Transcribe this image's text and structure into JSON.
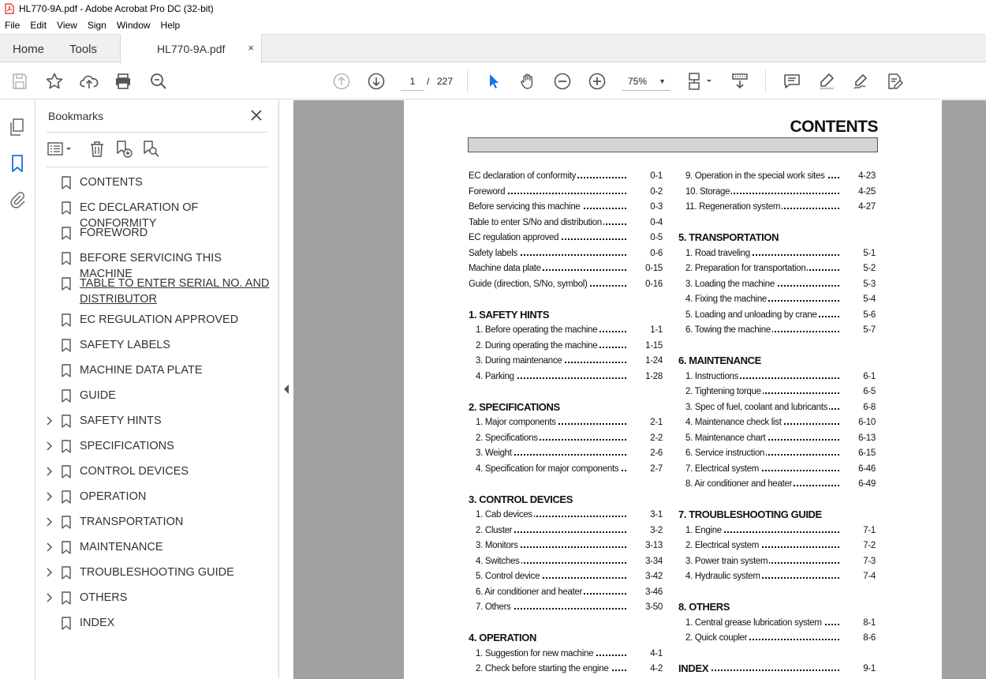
{
  "window": {
    "title": "HL770-9A.pdf - Adobe Acrobat Pro DC (32-bit)"
  },
  "menu": [
    "File",
    "Edit",
    "View",
    "Sign",
    "Window",
    "Help"
  ],
  "tabs": {
    "home": "Home",
    "tools": "Tools",
    "document": "HL770-9A.pdf",
    "close": "×"
  },
  "toolbar": {
    "page_current": "1",
    "page_sep": "/",
    "page_total": "227",
    "zoom": "75%"
  },
  "bookmarks": {
    "title": "Bookmarks",
    "items": [
      {
        "label": "CONTENTS",
        "expandable": false
      },
      {
        "label": "EC DECLARATION OF CONFORMITY",
        "expandable": false
      },
      {
        "label": "FOREWORD",
        "expandable": false
      },
      {
        "label": "BEFORE SERVICING THIS MACHINE",
        "expandable": false
      },
      {
        "label": "TABLE TO ENTER SERIAL NO. AND DISTRIBUTOR",
        "expandable": false,
        "hovered": true
      },
      {
        "label": "EC REGULATION APPROVED",
        "expandable": false
      },
      {
        "label": "SAFETY LABELS",
        "expandable": false
      },
      {
        "label": "MACHINE DATA PLATE",
        "expandable": false
      },
      {
        "label": "GUIDE",
        "expandable": false
      },
      {
        "label": "SAFETY HINTS",
        "expandable": true
      },
      {
        "label": "SPECIFICATIONS",
        "expandable": true
      },
      {
        "label": "CONTROL DEVICES",
        "expandable": true
      },
      {
        "label": "OPERATION",
        "expandable": true
      },
      {
        "label": "TRANSPORTATION",
        "expandable": true
      },
      {
        "label": "MAINTENANCE",
        "expandable": true
      },
      {
        "label": "TROUBLESHOOTING GUIDE",
        "expandable": true
      },
      {
        "label": "OTHERS",
        "expandable": true
      },
      {
        "label": "INDEX",
        "expandable": false
      }
    ]
  },
  "document": {
    "heading": "CONTENTS",
    "left_column": [
      {
        "type": "entry",
        "label": "EC declaration of conformity",
        "page": "0-1"
      },
      {
        "type": "entry",
        "label": "Foreword",
        "page": "0-2"
      },
      {
        "type": "entry",
        "label": "Before servicing this machine",
        "page": "0-3"
      },
      {
        "type": "entry",
        "label": "Table to enter S/No and distribution",
        "page": "0-4"
      },
      {
        "type": "entry",
        "label": "EC regulation approved",
        "page": "0-5"
      },
      {
        "type": "entry",
        "label": "Safety labels",
        "page": "0-6"
      },
      {
        "type": "entry",
        "label": "Machine data plate",
        "page": "0-15"
      },
      {
        "type": "entry",
        "label": "Guide (direction, S/No, symbol)",
        "page": "0-16"
      },
      {
        "type": "head",
        "label": "1. SAFETY HINTS"
      },
      {
        "type": "sub",
        "label": "1. Before operating the machine",
        "page": "1-1"
      },
      {
        "type": "sub",
        "label": "2. During operating the machine",
        "page": "1-15"
      },
      {
        "type": "sub",
        "label": "3. During maintenance",
        "page": "1-24"
      },
      {
        "type": "sub",
        "label": "4. Parking",
        "page": "1-28"
      },
      {
        "type": "head",
        "label": "2. SPECIFICATIONS"
      },
      {
        "type": "sub",
        "label": "1. Major components",
        "page": "2-1"
      },
      {
        "type": "sub",
        "label": "2. Specifications",
        "page": "2-2"
      },
      {
        "type": "sub",
        "label": "3. Weight",
        "page": "2-6"
      },
      {
        "type": "sub",
        "label": "4. Specification for major components",
        "page": "2-7"
      },
      {
        "type": "head",
        "label": "3. CONTROL DEVICES"
      },
      {
        "type": "sub",
        "label": "1. Cab devices",
        "page": "3-1"
      },
      {
        "type": "sub",
        "label": "2. Cluster",
        "page": "3-2"
      },
      {
        "type": "sub",
        "label": "3. Monitors",
        "page": "3-13"
      },
      {
        "type": "sub",
        "label": "4. Switches",
        "page": "3-34"
      },
      {
        "type": "sub",
        "label": "5. Control device",
        "page": "3-42"
      },
      {
        "type": "sub",
        "label": "6. Air conditioner and heater",
        "page": "3-46"
      },
      {
        "type": "sub",
        "label": "7. Others",
        "page": "3-50"
      },
      {
        "type": "head",
        "label": "4. OPERATION"
      },
      {
        "type": "sub",
        "label": "1. Suggestion for new machine",
        "page": "4-1"
      },
      {
        "type": "sub",
        "label": "2. Check before starting the engine",
        "page": "4-2"
      }
    ],
    "right_column": [
      {
        "type": "sub",
        "label": "9. Operation in the special work sites",
        "page": "4-23"
      },
      {
        "type": "sub",
        "label": "10. Storage",
        "page": "4-25"
      },
      {
        "type": "sub",
        "label": "11. Regeneration system",
        "page": "4-27"
      },
      {
        "type": "head",
        "label": "5. TRANSPORTATION"
      },
      {
        "type": "sub",
        "label": "1. Road traveling",
        "page": "5-1"
      },
      {
        "type": "sub",
        "label": "2. Preparation for transportation",
        "page": "5-2"
      },
      {
        "type": "sub",
        "label": "3. Loading the machine",
        "page": "5-3"
      },
      {
        "type": "sub",
        "label": "4. Fixing the machine",
        "page": "5-4"
      },
      {
        "type": "sub",
        "label": "5. Loading and unloading by crane",
        "page": "5-6"
      },
      {
        "type": "sub",
        "label": "6. Towing the machine",
        "page": "5-7"
      },
      {
        "type": "head",
        "label": "6. MAINTENANCE"
      },
      {
        "type": "sub",
        "label": "1. Instructions",
        "page": "6-1"
      },
      {
        "type": "sub",
        "label": "2. Tightening torque",
        "page": "6-5"
      },
      {
        "type": "sub",
        "label": "3. Spec of fuel, coolant and lubricants",
        "page": "6-8"
      },
      {
        "type": "sub",
        "label": "4. Maintenance check list",
        "page": "6-10"
      },
      {
        "type": "sub",
        "label": "5. Maintenance chart",
        "page": "6-13"
      },
      {
        "type": "sub",
        "label": "6. Service instruction",
        "page": "6-15"
      },
      {
        "type": "sub",
        "label": "7. Electrical system",
        "page": "6-46"
      },
      {
        "type": "sub",
        "label": "8. Air conditioner and heater",
        "page": "6-49"
      },
      {
        "type": "head",
        "label": "7. TROUBLESHOOTING GUIDE"
      },
      {
        "type": "sub",
        "label": "1. Engine",
        "page": "7-1"
      },
      {
        "type": "sub",
        "label": "2. Electrical system",
        "page": "7-2"
      },
      {
        "type": "sub",
        "label": "3. Power train system",
        "page": "7-3"
      },
      {
        "type": "sub",
        "label": "4. Hydraulic system",
        "page": "7-4"
      },
      {
        "type": "head",
        "label": "8. OTHERS"
      },
      {
        "type": "sub",
        "label": "1. Central grease lubrication system",
        "page": "8-1"
      },
      {
        "type": "sub",
        "label": "2. Quick coupler",
        "page": "8-6"
      },
      {
        "type": "headentry",
        "label": "INDEX",
        "page": "9-1"
      }
    ]
  },
  "colors": {
    "pdf_red": "#e0251b",
    "accent_blue": "#1473e6",
    "doc_bg": "#a0a0a0"
  }
}
